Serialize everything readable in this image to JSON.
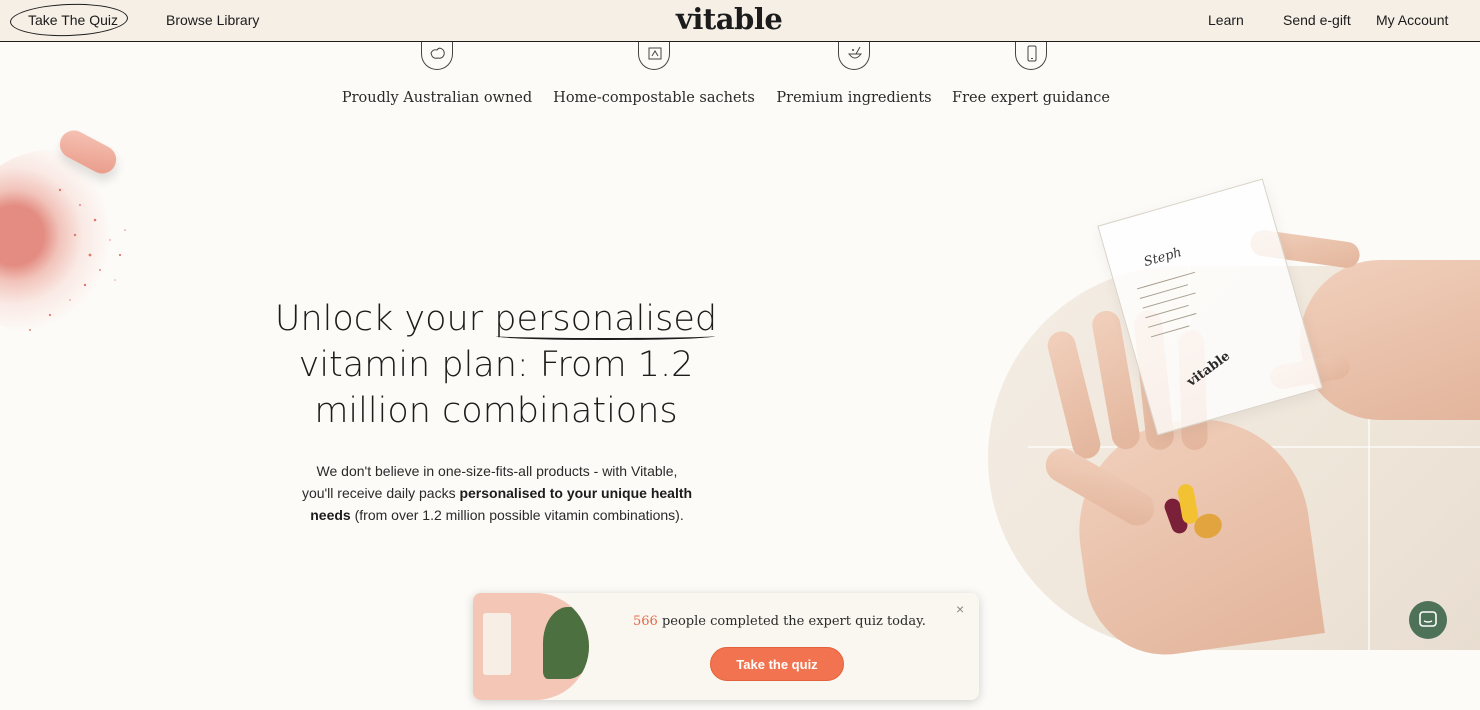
{
  "header": {
    "take_quiz": "Take The Quiz",
    "browse_library": "Browse Library",
    "logo": "vitable",
    "learn": "Learn",
    "send_egift": "Send e-gift",
    "my_account": "My Account"
  },
  "features": [
    {
      "label": "Proudly Australian owned",
      "icon": "australia-map-icon"
    },
    {
      "label": "Home-compostable sachets",
      "icon": "compostable-sachet-icon"
    },
    {
      "label": "Premium ingredients",
      "icon": "mortar-pestle-icon"
    },
    {
      "label": "Free expert guidance",
      "icon": "phone-icon"
    }
  ],
  "hero": {
    "title_part1": "Unlock your ",
    "title_emphasis": "personalised",
    "title_part2": " vitamin plan: From 1.2 million combinations",
    "body_part1": "We don't believe in one-size-fits-all products - with Vitable, you'll receive daily packs ",
    "body_bold": "personalised to your unique health needs",
    "body_part2": " (from over 1.2 million possible vitamin combinations)."
  },
  "sachet": {
    "name": "Steph",
    "brand": "vitable"
  },
  "popup": {
    "count": "566",
    "text": " people completed the expert quiz today.",
    "cta": "Take the quiz",
    "close": "×"
  },
  "colors": {
    "accent": "#f2734f",
    "chat": "#4e7258",
    "header_bg": "#f5efe6"
  }
}
